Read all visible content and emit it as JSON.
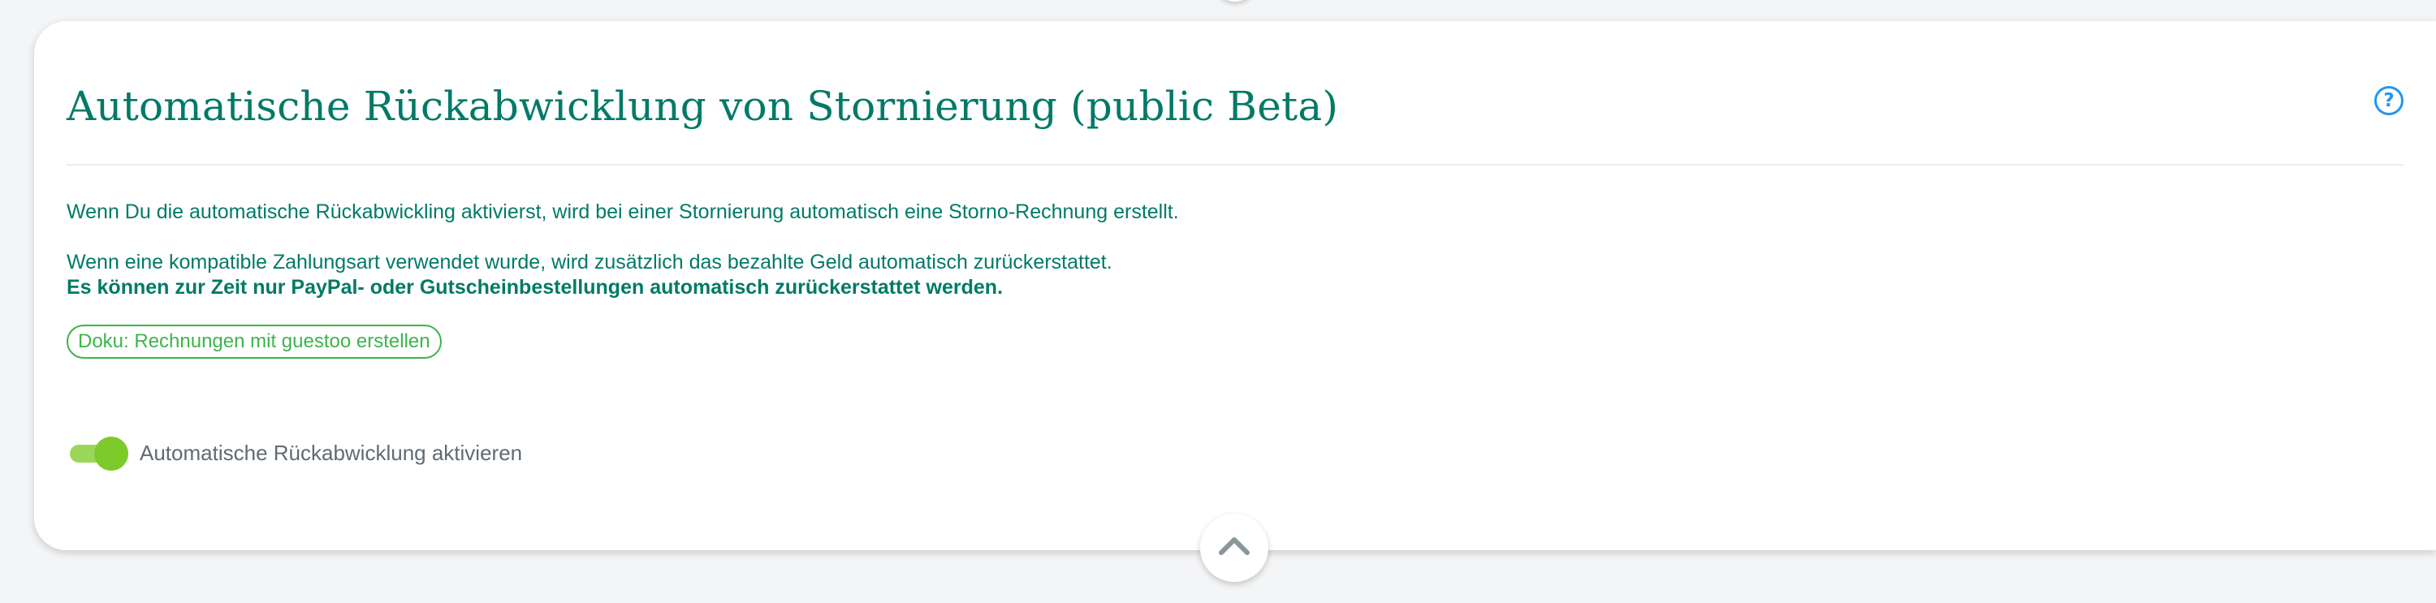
{
  "card": {
    "title": "Automatische Rückabwicklung von Stornierung (public Beta)",
    "help_icon": "question-circle-icon",
    "paragraphs": {
      "p1": "Wenn Du die automatische Rückabwickling aktivierst, wird bei einer Stornierung automatisch eine Storno-Rechnung erstellt.",
      "p2": "Wenn eine kompatible Zahlungsart verwendet wurde, wird zusätzlich das bezahlte Geld automatisch zurückerstattet.",
      "p3": "Es können zur Zeit nur PayPal- oder Gutscheinbestellungen automatisch zurückerstattet werden."
    },
    "doc_link_label": "Doku: Rechnungen mit guestoo erstellen",
    "toggle": {
      "label": "Automatische Rückabwicklung aktivieren",
      "state": "on"
    },
    "collapse_icon": "chevron-up-icon"
  },
  "colors": {
    "primary_text": "#007a67",
    "link_green": "#3cb54a",
    "toggle_green": "#7ccb2a",
    "help_blue": "#2196f3",
    "muted_text": "#5f6b72"
  }
}
